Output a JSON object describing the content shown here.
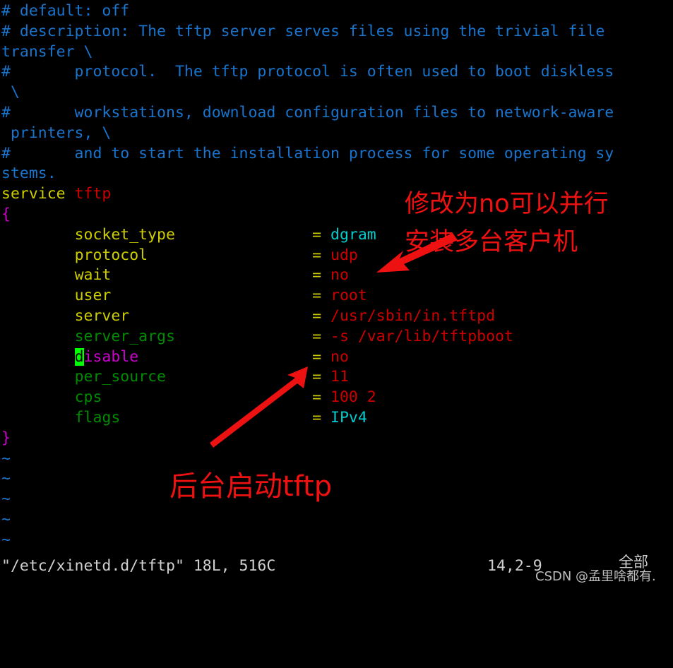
{
  "editor": {
    "name": "vim",
    "background": "#000000",
    "colors": {
      "comment": "#1874cd",
      "keyword": "#cdcd00",
      "value": "#cd0000",
      "identifier": "#008b00",
      "magenta": "#cd00cd",
      "cyan": "#00cdcd",
      "cursor_bg": "#00ff00",
      "annotation_red": "#ee1111",
      "status_fg": "#d0d0d0"
    },
    "lines": {
      "l01": "# default: off",
      "l02": "# description: The tftp server serves files using the trivial file",
      "l03": "transfer \\",
      "l04": "#       protocol.  The tftp protocol is often used to boot diskless",
      "l05": " \\",
      "l06": "#       workstations, download configuration files to network-aware",
      "l07": " printers, \\",
      "l08": "#       and to start the installation process for some operating sy",
      "l09": "stems.",
      "l10_kw": "service",
      "l10_name": "tftp",
      "l11_brace": "{",
      "l22_brace": "}",
      "tilde": "~"
    },
    "config_rows": [
      {
        "key": "socket_type",
        "key_color": "keyword",
        "eq": "=",
        "value": "dgram",
        "value_color": "cyan"
      },
      {
        "key": "protocol",
        "key_color": "keyword",
        "eq": "=",
        "value": "udp",
        "value_color": "value"
      },
      {
        "key": "wait",
        "key_color": "keyword",
        "eq": "=",
        "value": "no",
        "value_color": "value"
      },
      {
        "key": "user",
        "key_color": "keyword",
        "eq": "=",
        "value": "root",
        "value_color": "value"
      },
      {
        "key": "server",
        "key_color": "keyword",
        "eq": "=",
        "value": "/usr/sbin/in.tftpd",
        "value_color": "value"
      },
      {
        "key": "server_args",
        "key_color": "identifier",
        "eq": "=",
        "value": "-s /var/lib/tftpboot",
        "value_color": "value"
      },
      {
        "key": "disable",
        "key_color": "magenta",
        "eq": "=",
        "value": "no",
        "value_color": "value",
        "cursor_char": "d",
        "cursor_rest": "isable"
      },
      {
        "key": "per_source",
        "key_color": "identifier",
        "eq": "=",
        "value": "11",
        "value_color": "value"
      },
      {
        "key": "cps",
        "key_color": "identifier",
        "eq": "=",
        "value": "100 2",
        "value_color": "value"
      },
      {
        "key": "flags",
        "key_color": "identifier",
        "eq": "=",
        "value": "IPv4",
        "value_color": "cyan"
      }
    ],
    "tilde_count": 5
  },
  "statusline": {
    "file": "\"/etc/xinetd.d/tftp\" 18L, 516C",
    "position": "14,2-9",
    "scroll": "全部"
  },
  "annotations": [
    {
      "id": "wait-note-line1",
      "text": "修改为no可以并行"
    },
    {
      "id": "wait-note-line2",
      "text": "安装多台客户机"
    },
    {
      "id": "disable-note",
      "text": "后台启动tftp"
    }
  ],
  "arrows": [
    {
      "id": "arrow-to-wait",
      "direction": "down-left",
      "color": "#ee1111"
    },
    {
      "id": "arrow-to-disable",
      "direction": "up-right",
      "color": "#ee1111"
    }
  ],
  "watermark": {
    "text": "CSDN @孟里啥都有."
  }
}
